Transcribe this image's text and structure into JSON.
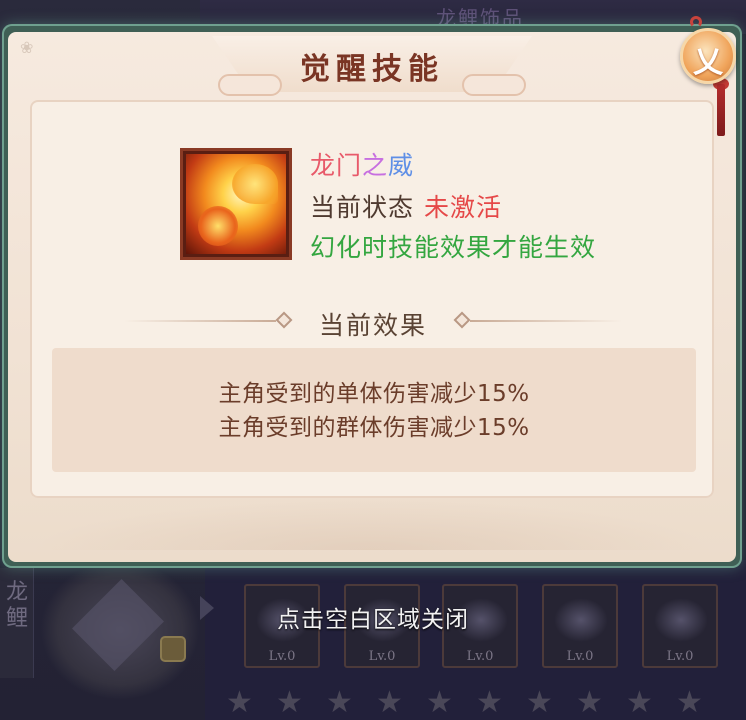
{
  "background": {
    "top_banner_text": "龙鲤饰品",
    "side_tab_text": "龙鲤",
    "skill_slots": [
      {
        "level": "Lv.0"
      },
      {
        "level": "Lv.0"
      },
      {
        "level": "Lv.0"
      },
      {
        "level": "Lv.0"
      },
      {
        "level": "Lv.0"
      }
    ],
    "star_glyph": "★",
    "stars_count": 10,
    "close_hint": "点击空白区域关闭"
  },
  "dialog": {
    "title": "觉醒技能",
    "close_glyph": "乂",
    "skill": {
      "name_parts": [
        {
          "text": "龙门",
          "color": "#e85a6a"
        },
        {
          "text": "之",
          "color": "#c76fe0"
        },
        {
          "text": "威",
          "color": "#5f8fe6"
        }
      ],
      "status_label": "当前状态",
      "status_value": "未激活",
      "effect_note": "幻化时技能效果才能生效"
    },
    "section_title": "当前效果",
    "effects": [
      "主角受到的单体伤害减少15%",
      "主角受到的群体伤害减少15%"
    ]
  },
  "colors": {
    "title": "#7a3524",
    "status_inactive": "#e54848",
    "effect_note": "#34a640",
    "effect_text": "#6b3d2a"
  }
}
